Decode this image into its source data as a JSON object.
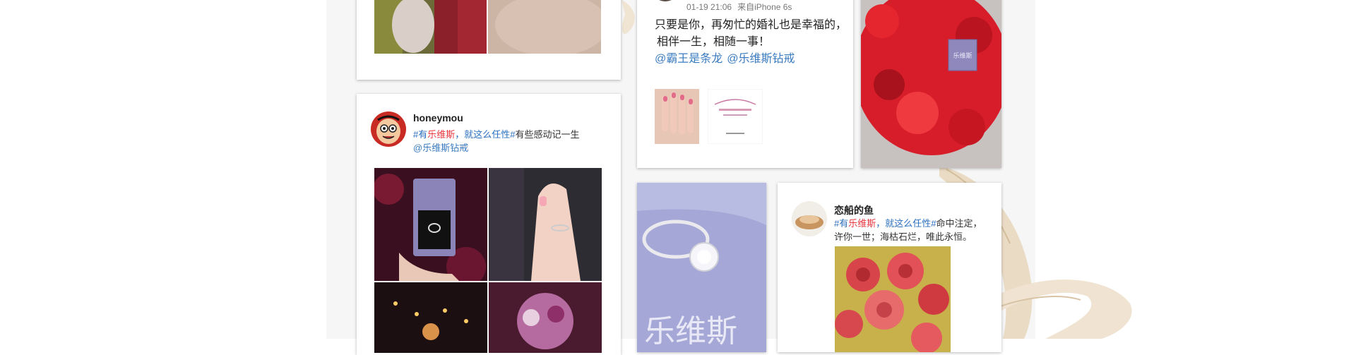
{
  "feed": {
    "card_top_left": {},
    "card_honeymou": {
      "username": "honeymou",
      "hashtag_prefix": "#有",
      "brand_word": "乐维斯",
      "hashtag_suffix": "，就这么任性#",
      "text": "有些感动记一生",
      "mention": "@乐维斯钻戒"
    },
    "card_marriage": {
      "time": "01-19 21:06",
      "via": "来自iPhone 6s",
      "line1": "只要是你，再匆忙的婚礼也是幸福的，",
      "line2": "相伴一生，相随一事！",
      "mention1": "@霸王是条龙",
      "mention2": "@乐维斯钻戒"
    },
    "card_roses": {
      "box_label": "乐维斯"
    },
    "card_ring_box": {
      "box_text": "乐维斯"
    },
    "card_fish": {
      "username": "恋船的鱼",
      "hashtag_prefix": "#有",
      "brand_word": "乐维斯",
      "hashtag_suffix": "，就这么任性#",
      "text_line1_tail": "命中注定，",
      "text_line2": "许你一世；海枯石烂，唯此永恒。"
    }
  },
  "colors": {
    "hashtag": "#2a6fbf",
    "brand": "#e8363e",
    "mention": "#3a7bbf",
    "ribbon": "#e8d6bd"
  }
}
